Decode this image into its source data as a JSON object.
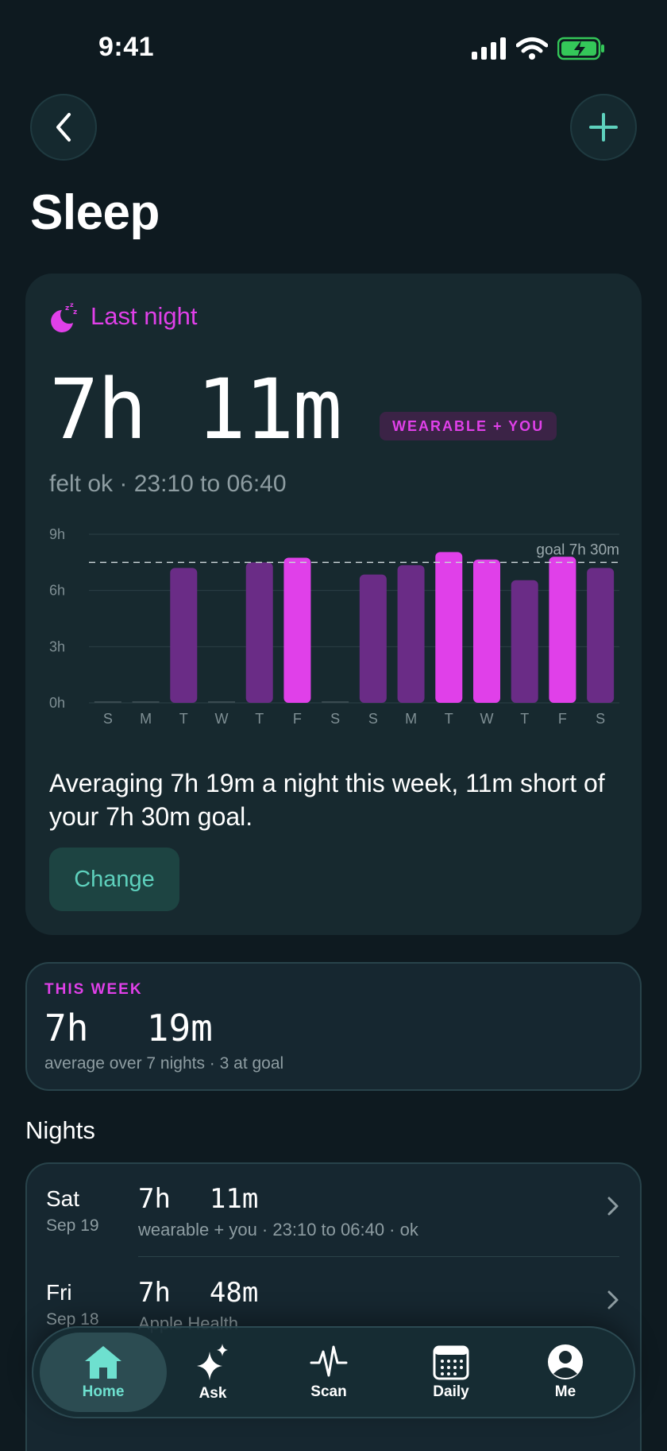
{
  "status_bar": {
    "time": "9:41"
  },
  "page": {
    "title": "Sleep"
  },
  "colors": {
    "accent": "#e040e9",
    "muted_bar": "#6a2c86",
    "teal": "#5ed1bd",
    "background": "#0e1a20"
  },
  "icons": {
    "back": "chevron-left-icon",
    "add": "plus-icon",
    "moon": "moon-zzz-icon",
    "chevron": "chevron-right-icon"
  },
  "last_night": {
    "label": "Last night",
    "hours": "7h",
    "minutes": "11m",
    "source_badge": "WEARABLE + YOU",
    "felt_line": "felt ok · 23:10 to 06:40"
  },
  "chart_data": {
    "type": "bar",
    "categories": [
      "S",
      "M",
      "T",
      "W",
      "T",
      "F",
      "S",
      "S",
      "M",
      "T",
      "W",
      "T",
      "F",
      "S"
    ],
    "values": [
      0,
      0,
      7.2,
      0,
      7.5,
      7.75,
      0,
      6.85,
      7.35,
      8.05,
      7.65,
      6.55,
      7.8,
      7.2
    ],
    "highlight": [
      false,
      false,
      false,
      false,
      false,
      true,
      false,
      false,
      false,
      true,
      true,
      false,
      true,
      false
    ],
    "yticks": [
      "0h",
      "3h",
      "6h",
      "9h"
    ],
    "ylim": [
      0,
      9
    ],
    "goal": 7.5,
    "goal_label": "goal 7h 30m",
    "grid": true
  },
  "summary": {
    "text": "Averaging 7h 19m a night this week, 11m short of your 7h 30m goal.",
    "change_label": "Change"
  },
  "this_week": {
    "label": "THIS WEEK",
    "hours": "7h",
    "minutes": "19m",
    "sub": "average over 7 nights · 3 at goal"
  },
  "nights": {
    "title": "Nights",
    "items": [
      {
        "day": "Sat",
        "date": "Sep 19",
        "hours": "7h",
        "minutes": "11m",
        "detail": "wearable + you · 23:10 to 06:40 · ok"
      },
      {
        "day": "Fri",
        "date": "Sep 18",
        "hours": "7h",
        "minutes": "48m",
        "detail": "Apple Health"
      }
    ]
  },
  "tabbar": {
    "items": [
      {
        "label": "Home",
        "icon": "home-icon",
        "active": true
      },
      {
        "label": "Ask",
        "icon": "sparkles-icon",
        "active": false
      },
      {
        "label": "Scan",
        "icon": "pulse-icon",
        "active": false
      },
      {
        "label": "Daily",
        "icon": "calendar-icon",
        "active": false
      },
      {
        "label": "Me",
        "icon": "profile-icon",
        "active": false
      }
    ]
  }
}
